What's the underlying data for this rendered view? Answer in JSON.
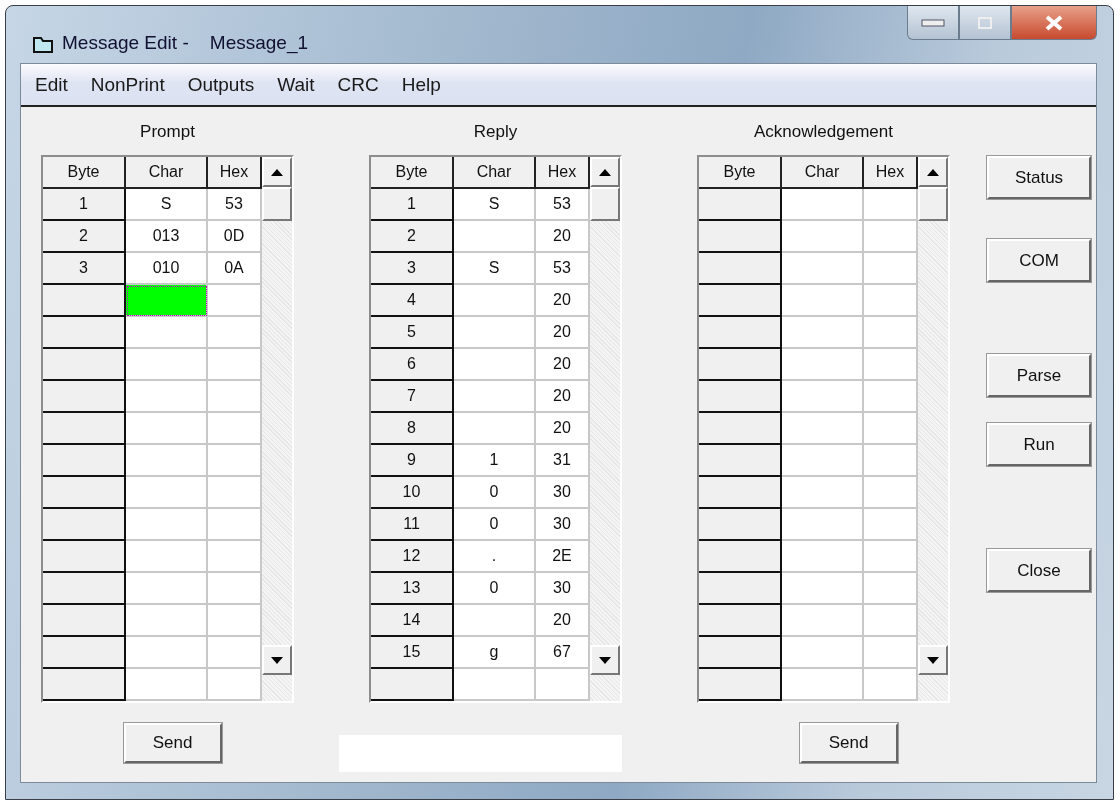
{
  "window": {
    "title_prefix": "Message Edit -",
    "title": "Message_1"
  },
  "menu": [
    "Edit",
    "NonPrint",
    "Outputs",
    "Wait",
    "CRC",
    "Help"
  ],
  "grids": [
    {
      "title": "Prompt",
      "columns": [
        "Byte",
        "Char",
        "Hex"
      ],
      "rows": [
        {
          "byte": "1",
          "char": "S",
          "hex": "53",
          "selected": false
        },
        {
          "byte": "2",
          "char": "013",
          "hex": "0D",
          "selected": false
        },
        {
          "byte": "3",
          "char": "010",
          "hex": "0A",
          "selected": false
        },
        {
          "selected": true
        }
      ]
    },
    {
      "title": "Reply",
      "columns": [
        "Byte",
        "Char",
        "Hex"
      ],
      "rows": [
        {
          "byte": "1",
          "char": "S",
          "hex": "53",
          "selected": false
        },
        {
          "byte": "2",
          "hex": "20",
          "selected": false
        },
        {
          "byte": "3",
          "char": "S",
          "hex": "53",
          "selected": false
        },
        {
          "byte": "4",
          "hex": "20",
          "selected": false
        },
        {
          "byte": "5",
          "hex": "20",
          "selected": false
        },
        {
          "byte": "6",
          "hex": "20",
          "selected": false
        },
        {
          "byte": "7",
          "hex": "20",
          "selected": false
        },
        {
          "byte": "8",
          "hex": "20",
          "selected": false
        },
        {
          "byte": "9",
          "char": "1",
          "hex": "31",
          "selected": false
        },
        {
          "byte": "10",
          "char": "0",
          "hex": "30",
          "selected": false
        },
        {
          "byte": "11",
          "char": "0",
          "hex": "30",
          "selected": false
        },
        {
          "byte": "12",
          "char": ".",
          "hex": "2E",
          "selected": false
        },
        {
          "byte": "13",
          "char": "0",
          "hex": "30",
          "selected": false
        },
        {
          "byte": "14",
          "hex": "20",
          "selected": false
        },
        {
          "byte": "15",
          "char": "g",
          "hex": "67",
          "selected": false
        }
      ]
    },
    {
      "title": "Acknowledgement",
      "columns": [
        "Byte",
        "Char",
        "Hex"
      ]
    }
  ],
  "bottom": [
    {
      "kind": "button",
      "label": "Send"
    },
    {
      "kind": "field"
    },
    {
      "kind": "button",
      "label": "Send"
    }
  ],
  "side_buttons": [
    "Status",
    "COM",
    "Parse",
    "Run",
    "Close"
  ]
}
